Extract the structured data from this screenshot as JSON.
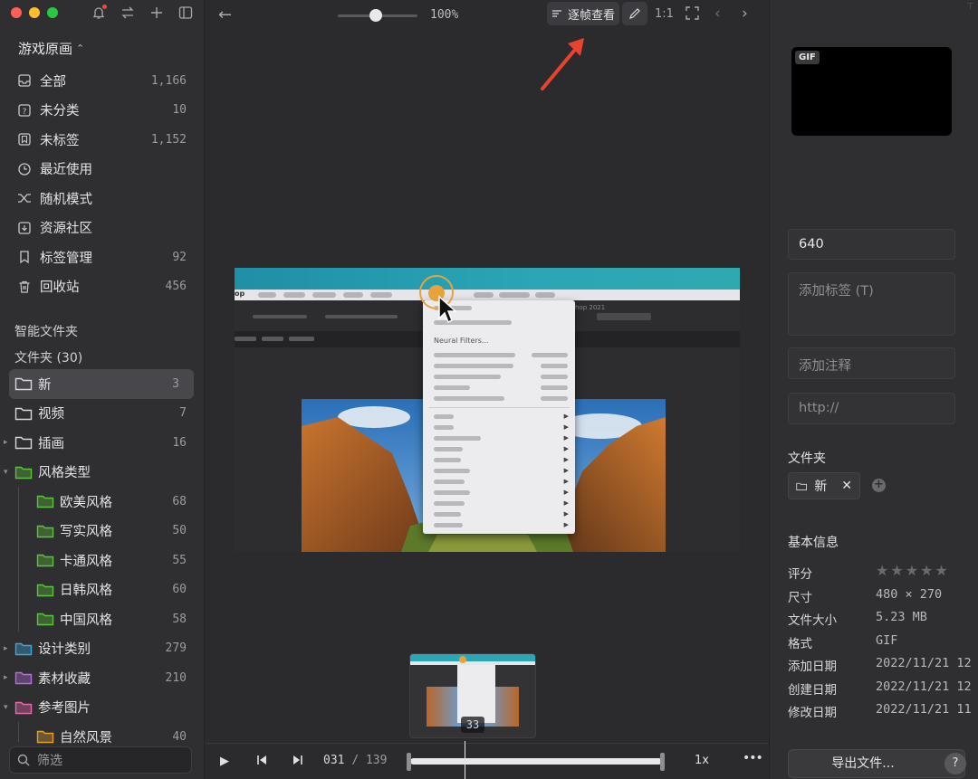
{
  "window": {
    "traffic": [
      "close",
      "minimize",
      "maximize"
    ]
  },
  "sidebar": {
    "library_title": "游戏原画",
    "nav": [
      {
        "icon": "inbox-icon",
        "label": "全部",
        "count": "1,166"
      },
      {
        "icon": "question-box-icon",
        "label": "未分类",
        "count": "10"
      },
      {
        "icon": "untagged-icon",
        "label": "未标签",
        "count": "1,152"
      },
      {
        "icon": "clock-icon",
        "label": "最近使用",
        "count": ""
      },
      {
        "icon": "shuffle-icon",
        "label": "随机模式",
        "count": ""
      },
      {
        "icon": "community-icon",
        "label": "资源社区",
        "count": ""
      },
      {
        "icon": "bookmark-icon",
        "label": "标签管理",
        "count": "92"
      },
      {
        "icon": "trash-icon",
        "label": "回收站",
        "count": "456"
      }
    ],
    "smart_folders": "智能文件夹",
    "folders_header": "文件夹 (30)",
    "folders": [
      {
        "label": "新",
        "count": "3",
        "color": "#d8d8da",
        "active": true,
        "caret": ""
      },
      {
        "label": "视频",
        "count": "7",
        "color": "#d8d8da",
        "caret": ""
      },
      {
        "label": "插画",
        "count": "16",
        "color": "#d8d8da",
        "caret": "▸"
      },
      {
        "label": "风格类型",
        "count": "",
        "color": "#5cc23c",
        "caret": "▾"
      },
      {
        "label": "欧美风格",
        "count": "68",
        "color": "#5cc23c",
        "indent": true
      },
      {
        "label": "写实风格",
        "count": "50",
        "color": "#5cc23c",
        "indent": true
      },
      {
        "label": "卡通风格",
        "count": "55",
        "color": "#5cc23c",
        "indent": true
      },
      {
        "label": "日韩风格",
        "count": "60",
        "color": "#5cc23c",
        "indent": true
      },
      {
        "label": "中国风格",
        "count": "58",
        "color": "#5cc23c",
        "indent": true
      },
      {
        "label": "设计类别",
        "count": "279",
        "color": "#3aa8e0",
        "caret": "▸"
      },
      {
        "label": "素材收藏",
        "count": "210",
        "color": "#b46ce0",
        "caret": "▸"
      },
      {
        "label": "参考图片",
        "count": "",
        "color": "#e86aa8",
        "caret": "▾"
      },
      {
        "label": "自然风景",
        "count": "40",
        "color": "#e0a030",
        "indent": true
      }
    ],
    "filter_placeholder": "筛选"
  },
  "toolbar": {
    "zoom": "100%",
    "zoom_level": 0.5,
    "frame_view_label": "逐帧查看",
    "one_to_one": "1:1"
  },
  "preview": {
    "menu_item": "Neural Filters...",
    "menu_partial_left": "op",
    "menu_partial_right": "hop 2021"
  },
  "filmstrip": {
    "current_thumb": "33"
  },
  "player": {
    "current_frame": "031",
    "separator": "/",
    "total_frames": "139",
    "speed": "1x",
    "more": "•••"
  },
  "inspector": {
    "badge": "GIF",
    "name_value": "640",
    "tag_placeholder": "添加标签 (T)",
    "note_placeholder": "添加注释",
    "url_placeholder": "http://",
    "folder_section": "文件夹",
    "folder_chip": "新",
    "basic_info": "基本信息",
    "rating": 0,
    "info": [
      {
        "k": "评分",
        "v": ""
      },
      {
        "k": "尺寸",
        "v": "480 × 270"
      },
      {
        "k": "文件大小",
        "v": "5.23 MB"
      },
      {
        "k": "格式",
        "v": "GIF"
      },
      {
        "k": "添加日期",
        "v": "2022/11/21 12"
      },
      {
        "k": "创建日期",
        "v": "2022/11/21 12"
      },
      {
        "k": "修改日期",
        "v": "2022/11/21 11"
      }
    ],
    "export_label": "导出文件...",
    "help_label": "?"
  },
  "colors": {
    "accent_arrow": "#e8432e",
    "cursor": "#e8a23c"
  }
}
